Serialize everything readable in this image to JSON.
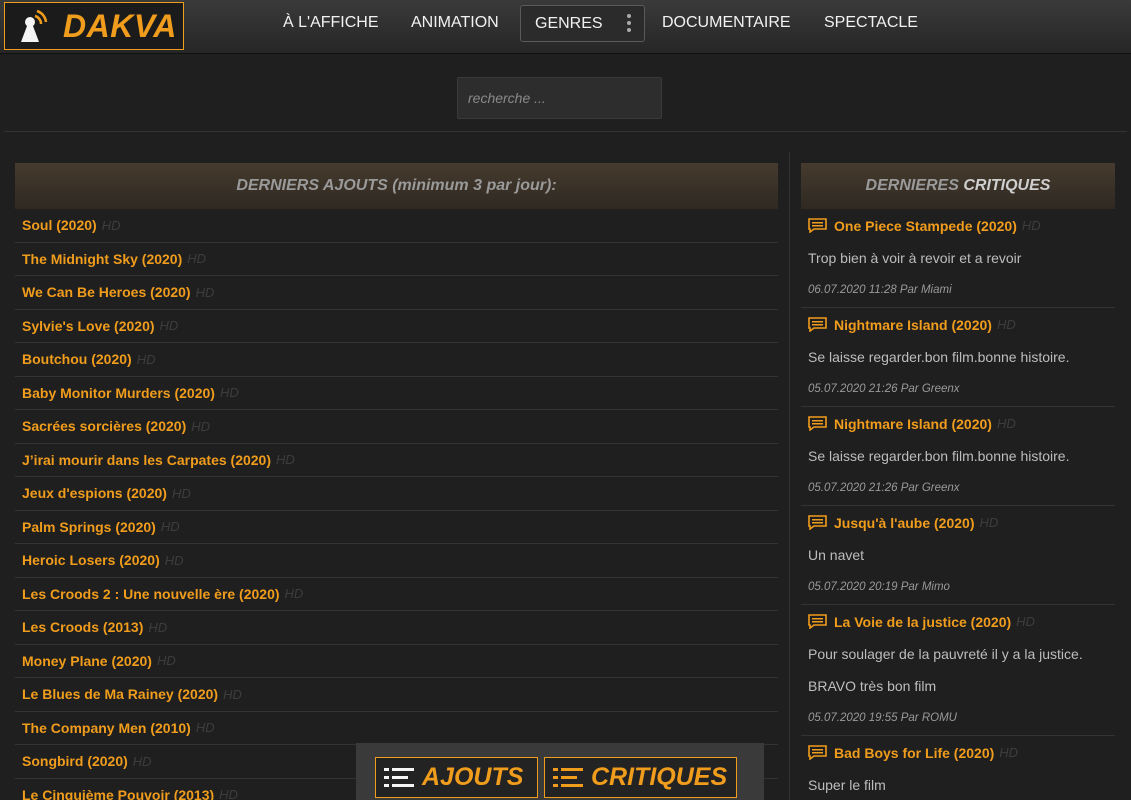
{
  "brand": {
    "name": "DAKVA",
    "accent": "#f09c1c"
  },
  "nav": {
    "affiche": "À L'AFFICHE",
    "animation": "ANIMATION",
    "genres": "GENRES",
    "documentaire": "DOCUMENTAIRE",
    "spectacle": "SPECTACLE"
  },
  "search": {
    "placeholder": "recherche ..."
  },
  "latest": {
    "header": "DERNIERS AJOUTS (minimum 3 par jour):",
    "quality": "HD",
    "items": [
      "Soul (2020)",
      "The Midnight Sky (2020)",
      "We Can Be Heroes (2020)",
      "Sylvie's Love (2020)",
      "Boutchou (2020)",
      "Baby Monitor Murders (2020)",
      "Sacrées sorcières (2020)",
      "J’irai mourir dans les Carpates (2020)",
      "Jeux d'espions (2020)",
      "Palm Springs (2020)",
      "Heroic Losers (2020)",
      "Les Croods 2 : Une nouvelle ère (2020)",
      "Les Croods (2013)",
      "Money Plane (2020)",
      "Le Blues de Ma Rainey (2020)",
      "The Company Men (2010)",
      "Songbird (2020)",
      "Le Cinquième Pouvoir (2013)"
    ]
  },
  "reviews": {
    "header_plain": "DERNIERES ",
    "header_accent": "CRITIQUES",
    "quality": "HD",
    "items": [
      {
        "title": "One Piece Stampede (2020)",
        "text": "Trop bien à voir à revoir et a revoir",
        "meta": "06.07.2020 11:28 Par Miami"
      },
      {
        "title": "Nightmare Island (2020)",
        "text": "Se laisse regarder.bon film.bonne histoire.",
        "meta": "05.07.2020 21:26 Par Greenx"
      },
      {
        "title": "Nightmare Island (2020)",
        "text": "Se laisse regarder.bon film.bonne histoire.",
        "meta": "05.07.2020 21:26 Par Greenx"
      },
      {
        "title": "Jusqu'à l'aube (2020)",
        "text": "Un navet",
        "meta": "05.07.2020 20:19 Par Mimo"
      },
      {
        "title": "La Voie de la justice (2020)",
        "text": "Pour soulager de la pauvreté il y a la justice. BRAVO très bon film",
        "meta": "05.07.2020 19:55 Par ROMU"
      },
      {
        "title": "Bad Boys for Life (2020)",
        "text": "Super le film",
        "meta": ""
      }
    ]
  },
  "bottom": {
    "ajouts": "AJOUTS",
    "critiques": "CRITIQUES"
  }
}
